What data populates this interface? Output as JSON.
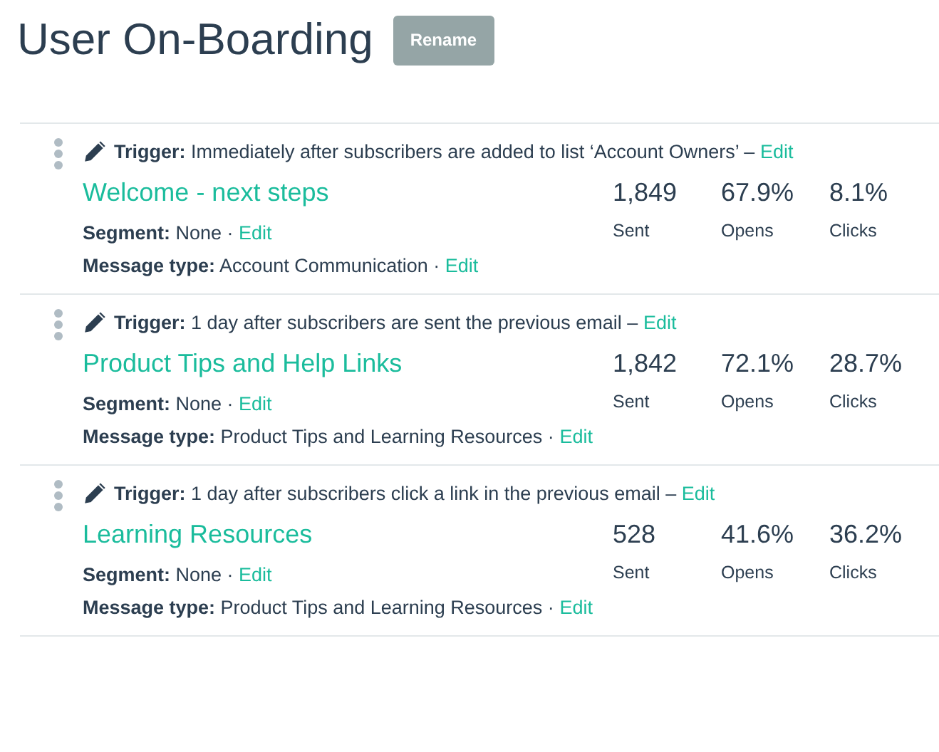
{
  "header": {
    "title": "User On-Boarding",
    "button": "Rename"
  },
  "emails": [
    {
      "trigger": {
        "text": "**Trigger:** Immediately after subscribers are added to list ‘Account Owners’ –",
        "edit": "Edit"
      },
      "title": "Welcome - next steps",
      "segment": {
        "text": "**Segment:** None ·",
        "edit": "Edit"
      },
      "message_type": {
        "text": "**Message type:** Account Communication ·",
        "edit": "Edit"
      },
      "stats": [
        {
          "value": "1,849",
          "label": "Sent"
        },
        {
          "value": "67.9%",
          "label": "Opens"
        },
        {
          "value": "8.1%",
          "label": "Clicks"
        }
      ]
    },
    {
      "trigger": {
        "text": "**Trigger:** 1 day after subscribers are sent the previous email –",
        "edit": "Edit"
      },
      "title": "Product Tips and Help Links",
      "segment": {
        "text": "**Segment:** None ·",
        "edit": "Edit"
      },
      "message_type": {
        "text": "**Message type:** Product Tips and Learning Resources ·",
        "edit": "Edit"
      },
      "stats": [
        {
          "value": "1,842",
          "label": "Sent"
        },
        {
          "value": "72.1%",
          "label": "Opens"
        },
        {
          "value": "28.7%",
          "label": "Clicks"
        }
      ]
    },
    {
      "trigger": {
        "text": "**Trigger:** 1 day after subscribers click a link in the previous email –",
        "edit": "Edit"
      },
      "title": "Learning Resources",
      "segment": {
        "text": "**Segment:** None ·",
        "edit": "Edit"
      },
      "message_type": {
        "text": "**Message type:** Product Tips and Learning Resources ·",
        "edit": "Edit"
      },
      "stats": [
        {
          "value": "528",
          "label": "Sent"
        },
        {
          "value": "41.6%",
          "label": "Opens"
        },
        {
          "value": "36.2%",
          "label": "Clicks"
        }
      ]
    }
  ]
}
